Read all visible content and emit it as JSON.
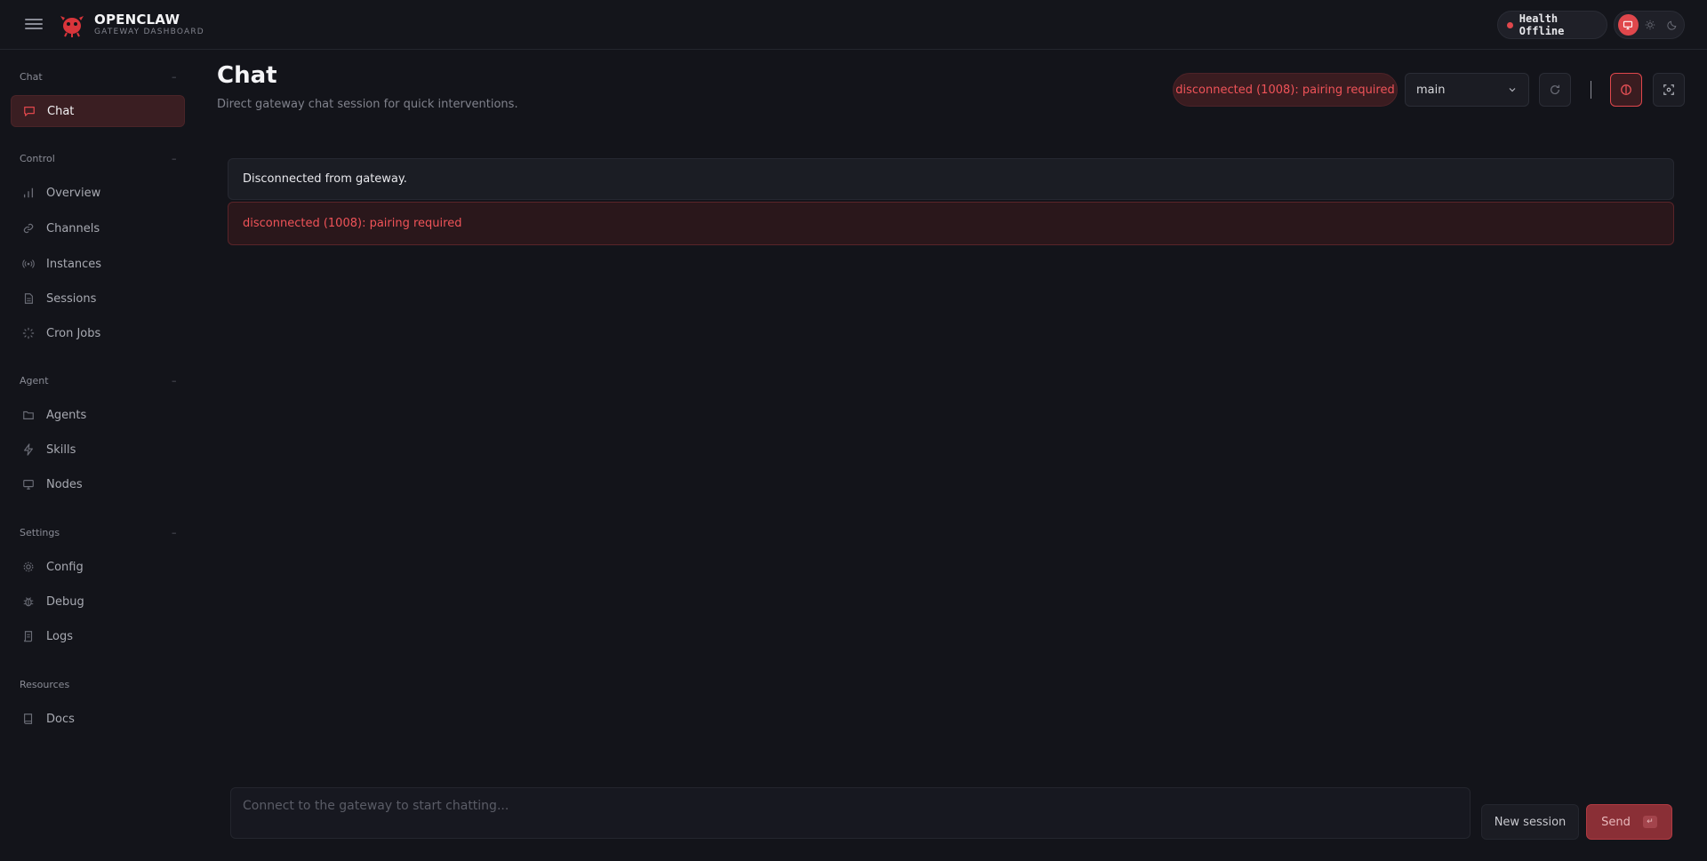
{
  "header": {
    "brand_title": "OPENCLAW",
    "brand_subtitle": "GATEWAY DASHBOARD",
    "health_label": "Health Offline",
    "accent_color": "#e0474c"
  },
  "sidebar": {
    "sections": [
      {
        "label": "Chat",
        "collapse": "–"
      },
      {
        "label": "Control",
        "collapse": "–"
      },
      {
        "label": "Agent",
        "collapse": "–"
      },
      {
        "label": "Settings",
        "collapse": "–"
      },
      {
        "label": "Resources"
      }
    ],
    "items": [
      {
        "label": "Chat",
        "icon": "message-icon",
        "active": true
      },
      {
        "label": "Overview",
        "icon": "bar-chart-icon"
      },
      {
        "label": "Channels",
        "icon": "link-icon"
      },
      {
        "label": "Instances",
        "icon": "radio-icon"
      },
      {
        "label": "Sessions",
        "icon": "file-icon"
      },
      {
        "label": "Cron Jobs",
        "icon": "loader-icon"
      },
      {
        "label": "Agents",
        "icon": "folder-icon"
      },
      {
        "label": "Skills",
        "icon": "zap-icon"
      },
      {
        "label": "Nodes",
        "icon": "monitor-icon"
      },
      {
        "label": "Config",
        "icon": "gear-icon"
      },
      {
        "label": "Debug",
        "icon": "bug-icon"
      },
      {
        "label": "Logs",
        "icon": "scroll-icon"
      },
      {
        "label": "Docs",
        "icon": "book-icon"
      }
    ]
  },
  "main": {
    "title": "Chat",
    "subtitle": "Direct gateway chat session for quick interventions.",
    "status_pill": "disconnected (1008): pairing required",
    "session_select": "main",
    "notice": "Disconnected from gateway.",
    "error": "disconnected (1008): pairing required"
  },
  "composer": {
    "placeholder": "Connect to the gateway to start chatting...",
    "new_session_label": "New session",
    "send_label": "Send",
    "send_shortcut": "↵"
  }
}
